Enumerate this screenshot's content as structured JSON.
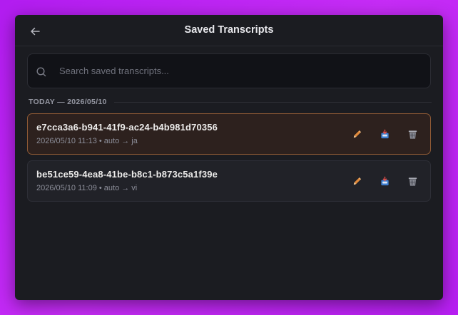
{
  "header": {
    "title": "Saved Transcripts"
  },
  "search": {
    "placeholder": "Search saved transcripts..."
  },
  "section": {
    "label": "TODAY — 2026/05/10"
  },
  "transcripts": [
    {
      "id": "e7cca3a6-b941-41f9-ac24-b4b981d70356",
      "meta": "2026/05/10 11:13 • auto → ja",
      "selected": true
    },
    {
      "id": "be51ce59-4ea8-41be-b8c1-b873c5a1f39e",
      "meta": "2026/05/10 11:09 • auto → vi",
      "selected": false
    }
  ],
  "colors": {
    "accent_border": "#8f5a35",
    "window_bg": "#1b1c21",
    "background": "#c22af5"
  },
  "icons": {
    "back": "arrow-left-icon",
    "search": "search-icon",
    "edit": "pencil-icon",
    "export": "inbox-tray-icon",
    "delete": "wastebasket-icon"
  }
}
